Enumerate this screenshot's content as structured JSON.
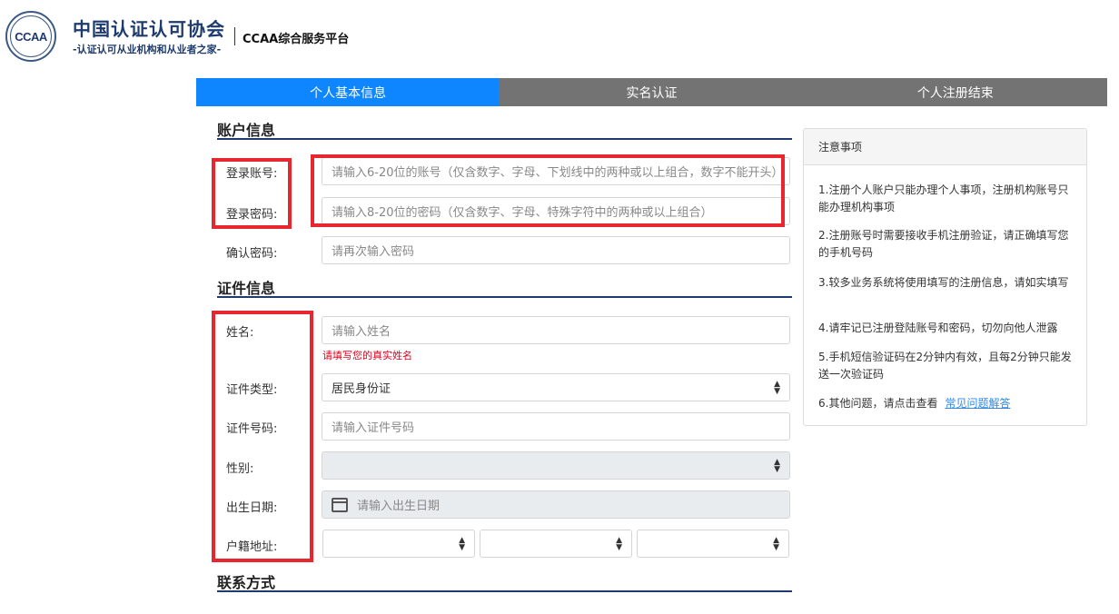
{
  "header": {
    "logo_text": "CCAA",
    "org_name": "中国认证认可协会",
    "org_slogan": "-认证认可从业机构和从业者之家-",
    "platform_name": "CCAA综合服务平台"
  },
  "steps": [
    {
      "label": "个人基本信息",
      "active": true
    },
    {
      "label": "实名认证",
      "active": false
    },
    {
      "label": "个人注册结束",
      "active": false
    }
  ],
  "account_section": {
    "title": "账户信息",
    "login_account": {
      "label": "登录账号:",
      "placeholder": "请输入6-20位的账号（仅含数字、字母、下划线中的两种或以上组合，数字不能开头）"
    },
    "login_password": {
      "label": "登录密码:",
      "placeholder": "请输入8-20位的密码（仅含数字、字母、特殊字符中的两种或以上组合）"
    },
    "confirm_password": {
      "label": "确认密码:",
      "placeholder": "请再次输入密码"
    }
  },
  "id_section": {
    "title": "证件信息",
    "name": {
      "label": "姓名:",
      "placeholder": "请输入姓名",
      "hint": "请填写您的真实姓名"
    },
    "id_type": {
      "label": "证件类型:",
      "value": "居民身份证"
    },
    "id_number": {
      "label": "证件号码:",
      "placeholder": "请输入证件号码"
    },
    "gender": {
      "label": "性别:",
      "value": ""
    },
    "birth_date": {
      "label": "出生日期:",
      "placeholder": "请输入出生日期"
    },
    "household": {
      "label": "户籍地址:"
    }
  },
  "contact_section": {
    "title": "联系方式"
  },
  "notice": {
    "title": "注意事项",
    "items": [
      "1.注册个人账户只能办理个人事项，注册机构账号只能办理机构事项",
      "2.注册账号时需要接收手机注册验证，请正确填写您的手机号码",
      "3.较多业务系统将使用填写的注册信息，请如实填写",
      "4.请牢记已注册登陆账号和密码，切勿向他人泄露",
      "5.手机短信验证码在2分钟内有效，且每2分钟只能发送一次验证码",
      "6.其他问题，请点击查看"
    ],
    "faq_link": "常见问题解答"
  },
  "colors": {
    "active_step": "#0d86ff",
    "inactive_step": "#737373",
    "annotation_red": "#e8262d",
    "brand_navy": "#1d3b6e",
    "hint_red": "#e0001b",
    "link_blue": "#2f8ae5"
  }
}
